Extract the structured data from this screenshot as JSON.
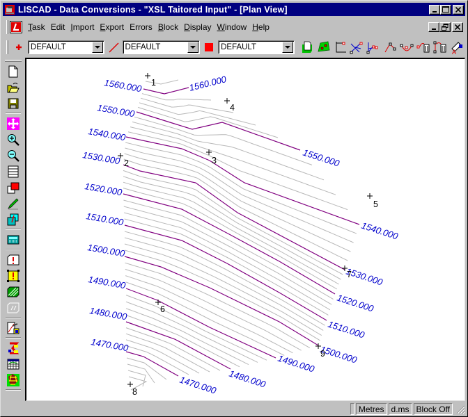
{
  "window": {
    "title": "LISCAD - Data Conversions - \"XSL Taitored Input\" - [Plan View]",
    "controls": [
      "minimize",
      "maximize",
      "close"
    ],
    "mdi_controls": [
      "minimize",
      "restore",
      "close"
    ]
  },
  "menubar": {
    "items": [
      {
        "label": "Task",
        "mnemonic": "T",
        "rest": "ask"
      },
      {
        "label": "Edit",
        "mnemonic": "E",
        "rest": "dit"
      },
      {
        "label": "Import",
        "mnemonic": "I",
        "rest": "mport"
      },
      {
        "label": "Export",
        "mnemonic": "E",
        "rest": "xport"
      },
      {
        "label": "Errors",
        "mnemonic": "E",
        "rest": "rrors"
      },
      {
        "label": "Block",
        "mnemonic": "B",
        "rest": "lock"
      },
      {
        "label": "Display",
        "mnemonic": "D",
        "rest": "isplay"
      },
      {
        "label": "Window",
        "mnemonic": "W",
        "rest": "indow"
      },
      {
        "label": "Help",
        "mnemonic": "H",
        "rest": "elp"
      }
    ]
  },
  "toolbar": {
    "point_style": "DEFAULT",
    "line_style": "DEFAULT",
    "area_style": "DEFAULT",
    "icons": [
      "new-sheet-icon",
      "edit-polygon-icon",
      "rectangle-point-icon",
      "intersect-lines-icon",
      "bearing-intersect-icon",
      "polyline-icon",
      "arc-icon",
      "delete-point-icon",
      "delete-line-icon",
      "text-edit-icon"
    ]
  },
  "left_toolbar": {
    "icons": [
      "new-file-icon",
      "open-folder-icon",
      "save-icon",
      "pan-icon",
      "zoom-in-icon",
      "zoom-out-icon",
      "window-icon",
      "layer-color-icon",
      "pencil-icon",
      "copy-icon",
      "calculator-icon",
      "error-icon",
      "warning-icon",
      "hatch-area-icon",
      "disabled-tool-icon",
      "properties-icon",
      "symbol-icon",
      "table-icon",
      "network-icon"
    ]
  },
  "plan_view": {
    "contour_labels": [
      {
        "text": "1560.000"
      },
      {
        "text": "1560.000"
      },
      {
        "text": "1550.000"
      },
      {
        "text": "1550.000"
      },
      {
        "text": "1540.000"
      },
      {
        "text": "1540.000"
      },
      {
        "text": "1530.000"
      },
      {
        "text": "1530.000"
      },
      {
        "text": "1520.000"
      },
      {
        "text": "1520.000"
      },
      {
        "text": "1510.000"
      },
      {
        "text": "1510.000"
      },
      {
        "text": "1500.000"
      },
      {
        "text": "1500.000"
      },
      {
        "text": "1490.000"
      },
      {
        "text": "1490.000"
      },
      {
        "text": "1480.000"
      },
      {
        "text": "1480.000"
      },
      {
        "text": "1470.000"
      },
      {
        "text": "1470.000"
      }
    ],
    "points": [
      {
        "id": "1"
      },
      {
        "id": "2"
      },
      {
        "id": "3"
      },
      {
        "id": "4"
      },
      {
        "id": "5"
      },
      {
        "id": "6"
      },
      {
        "id": "7"
      },
      {
        "id": "8"
      },
      {
        "id": "9"
      }
    ],
    "colors": {
      "major_contour": "#800080",
      "minor_contour": "#b8b8b8",
      "label": "#0000cc",
      "point": "#000000"
    }
  },
  "statusbar": {
    "units": "Metres",
    "angle_format": "d.ms",
    "block_status": "Block Off"
  }
}
